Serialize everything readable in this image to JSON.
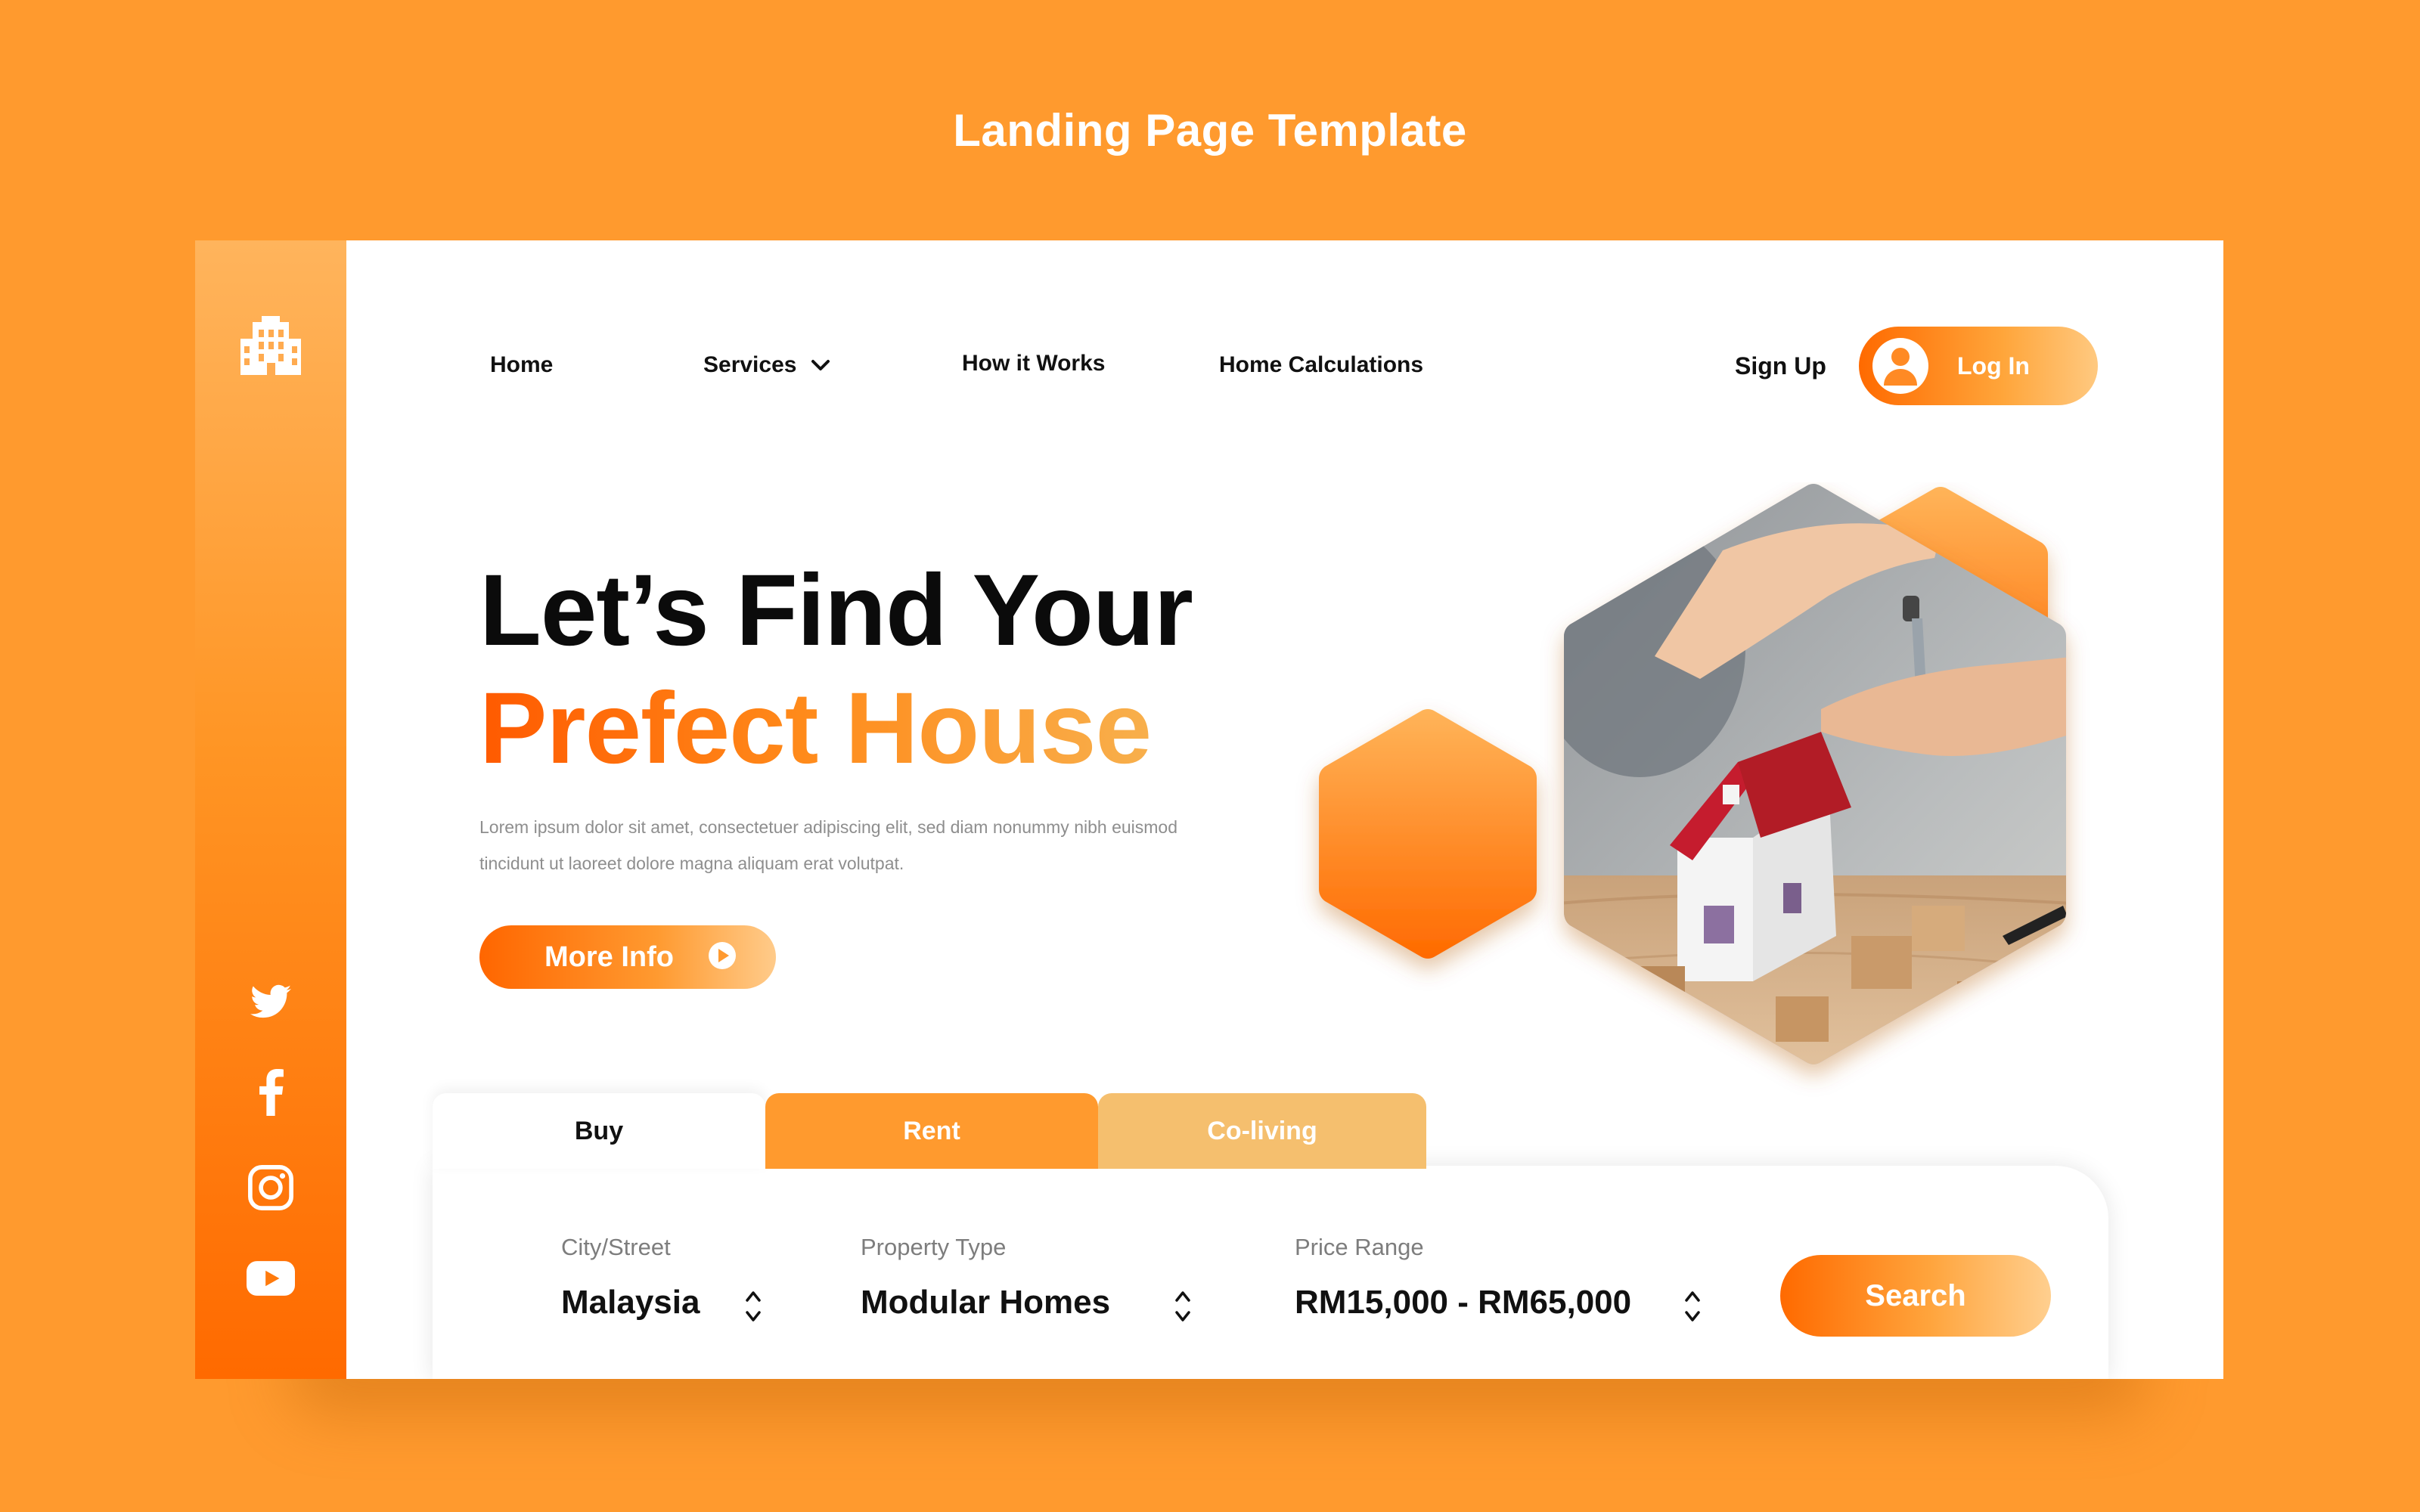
{
  "header": {
    "title": "Landing Page Template"
  },
  "sidebar": {
    "logo_icon": "building-icon",
    "social": [
      {
        "name": "twitter-icon"
      },
      {
        "name": "facebook-icon"
      },
      {
        "name": "instagram-icon"
      },
      {
        "name": "youtube-icon"
      }
    ]
  },
  "nav": {
    "items": [
      "Home",
      "Services",
      "How it Works",
      "Home Calculations"
    ],
    "sign_up": "Sign Up",
    "log_in": "Log In"
  },
  "hero": {
    "title_line1": "Let’s Find Your",
    "title_line2": "Prefect House",
    "description": "Lorem ipsum dolor sit amet, consectetuer adipiscing elit, sed diam nonummy nibh euismod tincidunt ut laoreet dolore magna aliquam erat volutpat.",
    "cta": "More Info"
  },
  "search": {
    "tabs": [
      "Buy",
      "Rent",
      "Co-living"
    ],
    "active_tab": "Buy",
    "fields": [
      {
        "label": "City/Street",
        "value": "Malaysia"
      },
      {
        "label": "Property Type",
        "value": "Modular Homes"
      },
      {
        "label": "Price Range",
        "value": "RM15,000 - RM65,000"
      }
    ],
    "button": "Search"
  },
  "colors": {
    "background": "#ff9a2e",
    "accent": "#ff6a00",
    "tab_rent": "#ff9a2e",
    "tab_coliving": "#f5bf6e"
  }
}
